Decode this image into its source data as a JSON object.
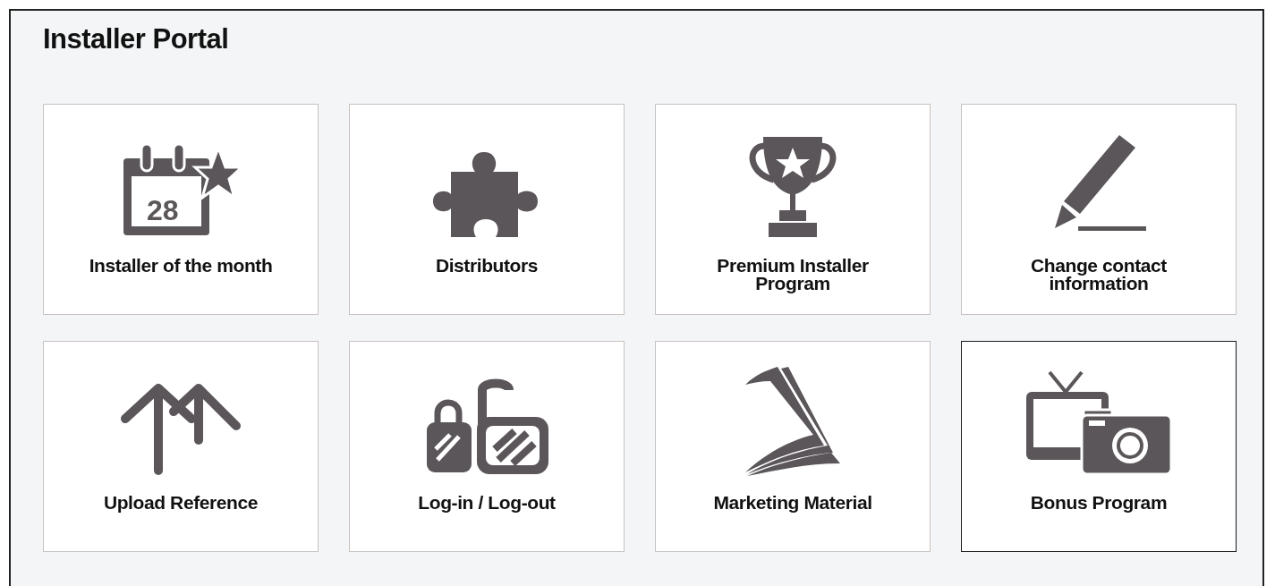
{
  "title": "Installer Portal",
  "tiles": [
    {
      "label": "Installer of the month",
      "kind": "calendar",
      "icon_text": "28",
      "selected": false
    },
    {
      "label": "Distributors",
      "kind": "puzzle",
      "selected": false
    },
    {
      "label": "Premium Installer\nProgram",
      "kind": "trophy",
      "selected": false
    },
    {
      "label": "Change contact\ninformation",
      "kind": "pencil",
      "selected": false
    },
    {
      "label": "Upload Reference",
      "kind": "arrows",
      "selected": false
    },
    {
      "label": "Log-in / Log-out",
      "kind": "locks",
      "selected": false
    },
    {
      "label": "Marketing Material",
      "kind": "papers",
      "selected": false
    },
    {
      "label": "Bonus Program",
      "kind": "camera",
      "selected": true
    }
  ]
}
